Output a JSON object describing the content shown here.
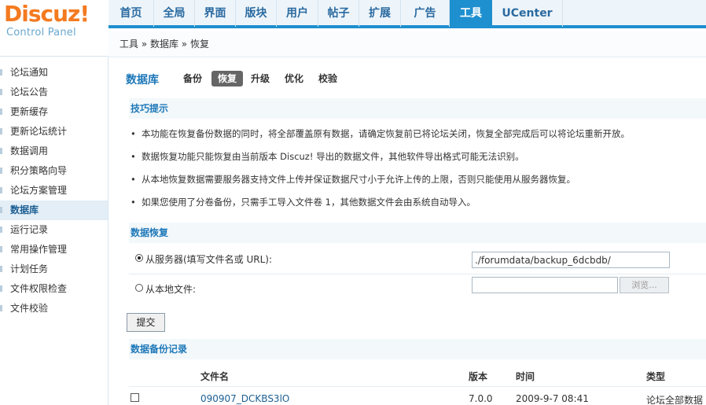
{
  "logo": {
    "brand": "Discuz!",
    "subtitle": "Control Panel"
  },
  "topnav": [
    "首页",
    "全局",
    "界面",
    "版块",
    "用户",
    "帖子",
    "扩展",
    "广告",
    "工具",
    "UCenter"
  ],
  "breadcrumb": "工具 » 数据库 » 恢复",
  "sidebar": [
    "论坛通知",
    "论坛公告",
    "更新缓存",
    "更新论坛统计",
    "数据调用",
    "积分策略向导",
    "论坛方案管理",
    "数据库",
    "运行记录",
    "常用操作管理",
    "计划任务",
    "文件权限检查",
    "文件校验"
  ],
  "page": {
    "title": "数据库",
    "tabs": [
      "备份",
      "恢复",
      "升级",
      "优化",
      "校验"
    ]
  },
  "tips": {
    "heading": "技巧提示",
    "items": [
      "本功能在恢复备份数据的同时，将全部覆盖原有数据，请确定恢复前已将论坛关闭，恢复全部完成后可以将论坛重新开放。",
      "数据恢复功能只能恢复由当前版本 Discuz! 导出的数据文件，其他软件导出格式可能无法识别。",
      "从本地恢复数据需要服务器支持文件上传并保证数据尺寸小于允许上传的上限，否则只能使用从服务器恢复。",
      "如果您使用了分卷备份，只需手工导入文件卷 1，其他数据文件会由系统自动导入。"
    ]
  },
  "restore": {
    "heading": "数据恢复",
    "server_label": "从服务器(填写文件名或  URL):",
    "server_value": "./forumdata/backup_6dcbdb/",
    "local_label": "从本地文件:",
    "browse_label": "浏览...",
    "submit_label": "提交"
  },
  "records": {
    "heading": "数据备份记录",
    "columns": [
      "文件名",
      "版本",
      "时间",
      "类型"
    ],
    "rows": [
      {
        "file": "090907_DCKBS3lO",
        "version": "7.0.0",
        "time": "2009-9-7 08:41",
        "type": "论坛全部数据"
      }
    ]
  },
  "colors": {
    "accent": "#1e8fcf",
    "heading": "#1e78b8",
    "logo": "#f47a20"
  }
}
